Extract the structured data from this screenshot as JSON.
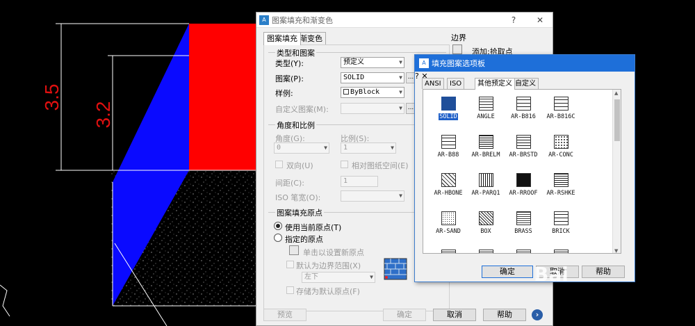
{
  "colors": {
    "red": "#ff0000",
    "blue": "#0a0aff",
    "dim": "#e01010",
    "accent": "#1e6fd9"
  },
  "canvas": {
    "dim_outer": "3.5",
    "dim_inner": "3.2"
  },
  "main": {
    "title": "图案填充和渐变色",
    "help_glyph": "?",
    "close_glyph": "✕",
    "tab_hatch": "图案填充",
    "tab_gradient": "渐变色",
    "type_group": "类型和图案",
    "type_label": "类型(Y):",
    "type_value": "预定义",
    "pattern_label": "图案(P):",
    "pattern_value": "SOLID",
    "sample_label": "样例:",
    "sample_value": "ByBlock",
    "custom_label": "自定义图案(M):",
    "angle_group": "角度和比例",
    "angle_label": "角度(G):",
    "angle_value": "0",
    "scale_label": "比例(S):",
    "scale_value": "1",
    "double_label": "双向(U)",
    "relative_label": "相对图纸空间(E)",
    "spacing_label": "间距(C):",
    "spacing_value": "1",
    "iso_label": "ISO 笔宽(O):",
    "origin_group": "图案填充原点",
    "use_current": "使用当前原点(T)",
    "specify": "指定的原点",
    "click_set": "单击以设置新原点",
    "default_boundary": "默认为边界范围(X)",
    "position_value": "左下",
    "store_default": "存储为默认原点(F)",
    "boundary_group": "边界",
    "add_pick": "添加:拾取点",
    "preview_btn": "预览",
    "ok_btn": "确定",
    "cancel_btn": "取消",
    "help_btn": "帮助",
    "more_glyph": "›",
    "dots": "..."
  },
  "palette": {
    "title": "填充图案选项板",
    "help_glyph": "?",
    "close_glyph": "✕",
    "tabs": [
      "ANSI",
      "ISO",
      "其他预定义",
      "自定义"
    ],
    "patterns": [
      "SOLID",
      "ANGLE",
      "AR-B816",
      "AR-B816C",
      "AR-B88",
      "AR-BRELM",
      "AR-BRSTD",
      "AR-CONC",
      "AR-HBONE",
      "AR-PARQ1",
      "AR-RROOF",
      "AR-RSHKE",
      "AR-SAND",
      "BOX",
      "BRASS",
      "BRICK"
    ],
    "selected": "SOLID",
    "ok_btn": "确定",
    "cancel_btn": "取消",
    "help_btn": "帮助"
  },
  "watermark": "Bai"
}
